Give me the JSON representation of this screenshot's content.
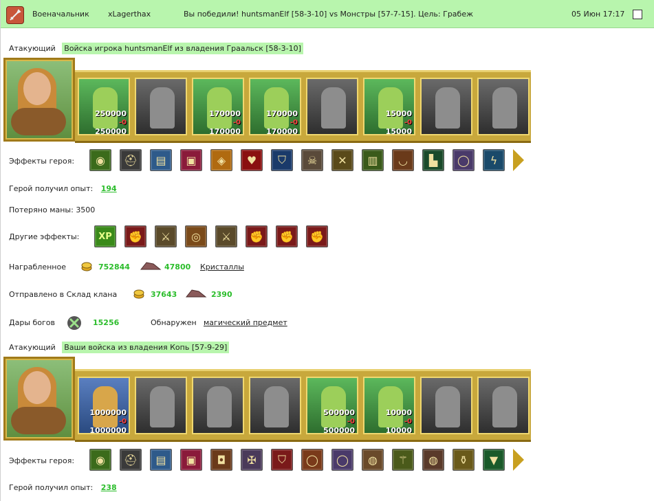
{
  "header": {
    "title": "Военачальник",
    "player": "xLagerthax",
    "result": "Вы победили! huntsmanElf [58-3-10] vs Монстры [57-7-15]. Цель: Грабеж",
    "datetime": "05 Июн 17:17"
  },
  "section1": {
    "attacker_label": "Атакующий",
    "attacker_value": "Войска игрока huntsmanElf из владения Граальск [58-3-10]",
    "units": [
      {
        "top": "250000",
        "lost": "-0",
        "bottom": "250000",
        "color": true
      },
      {
        "top": "",
        "lost": "",
        "bottom": "",
        "color": false
      },
      {
        "top": "170000",
        "lost": "-0",
        "bottom": "170000",
        "color": true
      },
      {
        "top": "170000",
        "lost": "-0",
        "bottom": "170000",
        "color": true
      },
      {
        "top": "",
        "lost": "",
        "bottom": "",
        "color": false
      },
      {
        "top": "15000",
        "lost": "-0",
        "bottom": "15000",
        "color": true
      },
      {
        "top": "",
        "lost": "",
        "bottom": "",
        "color": false
      },
      {
        "top": "",
        "lost": "",
        "bottom": "",
        "color": false
      }
    ],
    "hero_effects_label": "Эффекты героя:",
    "hero_effects": [
      {
        "name": "gold-seed-icon",
        "glyph": "◉",
        "bg": "#3b6b1b"
      },
      {
        "name": "knight-helmet-icon",
        "glyph": "⛑",
        "bg": "#3a3a3a"
      },
      {
        "name": "scroll-icon",
        "glyph": "▤",
        "bg": "#2e5a8a"
      },
      {
        "name": "chest-icon",
        "glyph": "▣",
        "bg": "#8a1a3a"
      },
      {
        "name": "treasure-icon",
        "glyph": "◈",
        "bg": "#b06a10"
      },
      {
        "name": "heart-icon",
        "glyph": "♥",
        "bg": "#8a1010"
      },
      {
        "name": "shield-icon",
        "glyph": "⛉",
        "bg": "#1a3a6a"
      },
      {
        "name": "skull-icon",
        "glyph": "☠",
        "bg": "#5a4a3a"
      },
      {
        "name": "crossed-swords-icon",
        "glyph": "✕",
        "bg": "#5a4a1a"
      },
      {
        "name": "armor-icon",
        "glyph": "▥",
        "bg": "#3a5a1a"
      },
      {
        "name": "horn-icon",
        "glyph": "◡",
        "bg": "#6a3a1a"
      },
      {
        "name": "boots-icon",
        "glyph": "▙",
        "bg": "#1a4a2a"
      },
      {
        "name": "ring-icon",
        "glyph": "◯",
        "bg": "#4a3a6a"
      },
      {
        "name": "lightning-icon",
        "glyph": "ϟ",
        "bg": "#1a4a6a"
      }
    ],
    "exp_label": "Герой получил опыт:",
    "exp_value": "194",
    "mana_text": "Потеряно маны: 3500",
    "other_effects_label": "Другие эффекты:",
    "other_effects": [
      {
        "name": "xp-icon",
        "glyph": "XP",
        "bg": "#3a8a1a"
      },
      {
        "name": "sword-fist-icon",
        "glyph": "✊",
        "bg": "#7a1a1a"
      },
      {
        "name": "sword-icon",
        "glyph": "⚔",
        "bg": "#5a4a2a"
      },
      {
        "name": "coins-icon",
        "glyph": "◎",
        "bg": "#7a4a1a"
      },
      {
        "name": "sword-icon",
        "glyph": "⚔",
        "bg": "#5a4a2a"
      },
      {
        "name": "sword-fist-icon",
        "glyph": "✊",
        "bg": "#7a1a1a"
      },
      {
        "name": "sword-fist-icon",
        "glyph": "✊",
        "bg": "#7a1a1a"
      },
      {
        "name": "sword-fist-icon",
        "glyph": "✊",
        "bg": "#7a1a1a"
      }
    ],
    "loot_label": "Награбленное",
    "loot_gold": "752844",
    "loot_ore": "47800",
    "loot_link": "Кристаллы",
    "clan_label": "Отправлено в Склад клана",
    "clan_gold": "37643",
    "clan_ore": "2390",
    "gods_label": "Дары богов",
    "gods_value": "15256",
    "found_label": "Обнаружен",
    "found_link": "магический предмет"
  },
  "section2": {
    "attacker_label": "Атакующий",
    "attacker_value": "Ваши войска из владения Копь [57-9-29]",
    "units": [
      {
        "top": "1000000",
        "lost": "-0",
        "bottom": "1000000",
        "color": "blue"
      },
      {
        "top": "",
        "lost": "",
        "bottom": "",
        "color": false
      },
      {
        "top": "",
        "lost": "",
        "bottom": "",
        "color": false
      },
      {
        "top": "",
        "lost": "",
        "bottom": "",
        "color": false
      },
      {
        "top": "500000",
        "lost": "-0",
        "bottom": "500000",
        "color": true
      },
      {
        "top": "10000",
        "lost": "-0",
        "bottom": "10000",
        "color": true
      },
      {
        "top": "",
        "lost": "",
        "bottom": "",
        "color": false
      },
      {
        "top": "",
        "lost": "",
        "bottom": "",
        "color": false
      }
    ],
    "hero_effects_label": "Эффекты героя:",
    "hero_effects": [
      {
        "name": "gold-seed-icon",
        "glyph": "◉",
        "bg": "#3b6b1b"
      },
      {
        "name": "knight-helmet-icon",
        "glyph": "⛑",
        "bg": "#3a3a3a"
      },
      {
        "name": "scroll-icon",
        "glyph": "▤",
        "bg": "#2e5a8a"
      },
      {
        "name": "chest-icon",
        "glyph": "▣",
        "bg": "#8a1a3a"
      },
      {
        "name": "helmet-icon",
        "glyph": "◘",
        "bg": "#6a3a1a"
      },
      {
        "name": "cross-icon",
        "glyph": "✠",
        "bg": "#4a3a5a"
      },
      {
        "name": "shield-crest-icon",
        "glyph": "⛉",
        "bg": "#7a1a1a"
      },
      {
        "name": "belt-icon",
        "glyph": "◯",
        "bg": "#7a3a1a"
      },
      {
        "name": "ring-icon",
        "glyph": "◯",
        "bg": "#4a3a6a"
      },
      {
        "name": "pouch-icon",
        "glyph": "◍",
        "bg": "#6a4a2a"
      },
      {
        "name": "staff-icon",
        "glyph": "⚚",
        "bg": "#4a5a1a"
      },
      {
        "name": "round-shield-icon",
        "glyph": "◍",
        "bg": "#5a3a2a"
      },
      {
        "name": "potion-icon",
        "glyph": "⚱",
        "bg": "#6a5a1a"
      },
      {
        "name": "cloak-icon",
        "glyph": "▼",
        "bg": "#1a5a2a"
      }
    ],
    "exp_label": "Герой получил опыт:",
    "exp_value": "238"
  }
}
